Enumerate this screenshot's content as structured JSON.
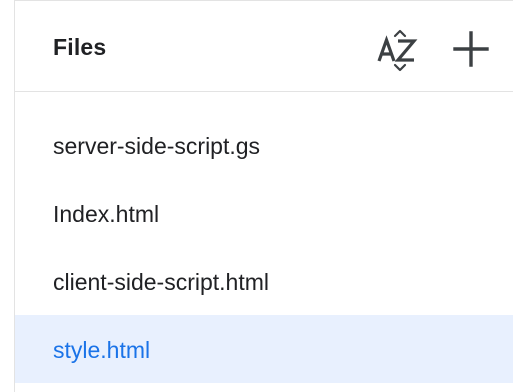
{
  "panel": {
    "title": "Files",
    "sort_icon": "sort-az-icon",
    "add_icon": "plus-icon"
  },
  "files": [
    {
      "name": "server-side-script.gs",
      "selected": false
    },
    {
      "name": "Index.html",
      "selected": false
    },
    {
      "name": "client-side-script.html",
      "selected": false
    },
    {
      "name": "style.html",
      "selected": true
    }
  ],
  "colors": {
    "text": "#202124",
    "selected_bg": "#e8f0fe",
    "selected_text": "#1a73e8",
    "icon": "#3c4043",
    "border": "#e3e3e3"
  }
}
